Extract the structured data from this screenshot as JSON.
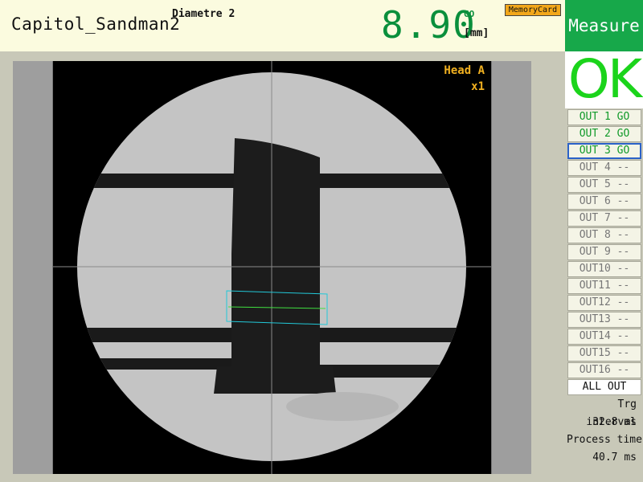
{
  "header": {
    "program_name": "Capitol_Sandman2",
    "measurement_name": "Diametre 2",
    "value": "8.90",
    "judgement": "GO",
    "unit": "[mm]",
    "memory_card": "MemoryCard"
  },
  "mode": {
    "label": "Measure"
  },
  "result": {
    "text": "OK"
  },
  "image": {
    "head": "Head A",
    "zoom": "x1"
  },
  "outputs": [
    {
      "label": "OUT 1 GO",
      "state": "go"
    },
    {
      "label": "OUT 2 GO",
      "state": "go"
    },
    {
      "label": "OUT 3 GO",
      "state": "go",
      "selected": true
    },
    {
      "label": "OUT 4 --",
      "state": "none"
    },
    {
      "label": "OUT 5 --",
      "state": "none"
    },
    {
      "label": "OUT 6 --",
      "state": "none"
    },
    {
      "label": "OUT 7 --",
      "state": "none"
    },
    {
      "label": "OUT 8 --",
      "state": "none"
    },
    {
      "label": "OUT 9 --",
      "state": "none"
    },
    {
      "label": "OUT10 --",
      "state": "none"
    },
    {
      "label": "OUT11 --",
      "state": "none"
    },
    {
      "label": "OUT12 --",
      "state": "none"
    },
    {
      "label": "OUT13 --",
      "state": "none"
    },
    {
      "label": "OUT14 --",
      "state": "none"
    },
    {
      "label": "OUT15 --",
      "state": "none"
    },
    {
      "label": "OUT16 --",
      "state": "none"
    }
  ],
  "all_out": "ALL OUT",
  "stats": {
    "trg_interval_label": "Trg interval",
    "trg_interval_value": "32.8 ms",
    "process_time_label": "Process time",
    "process_time_value": "40.7 ms"
  },
  "colors": {
    "value_green": "#0a8f3c",
    "ok_green": "#1bd41b",
    "mode_green": "#17a84a",
    "selected_border": "#2b62c8",
    "memory_card": "#f2a71a",
    "roi_cyan": "#22c8d8",
    "edge_green": "#40e040"
  }
}
